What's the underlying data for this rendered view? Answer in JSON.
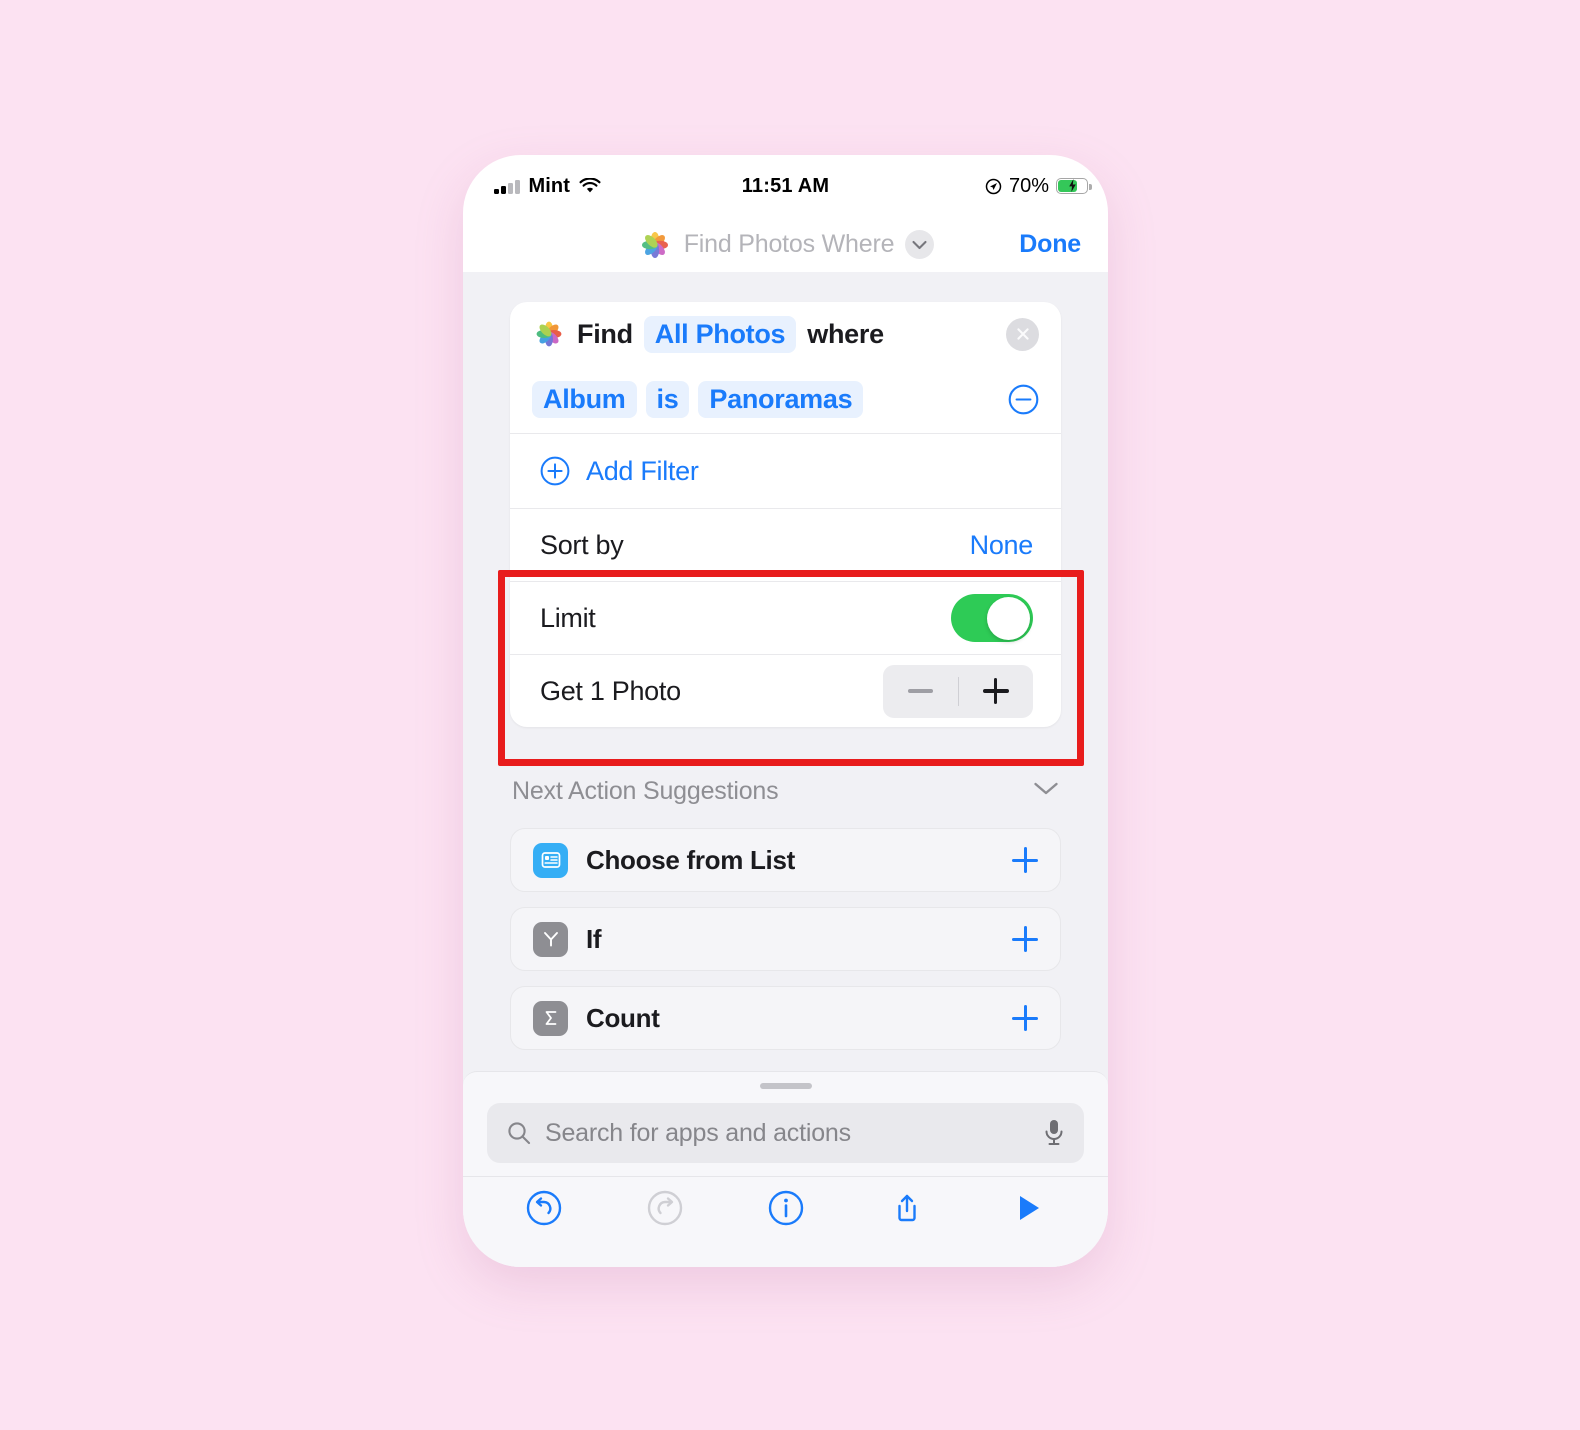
{
  "status_bar": {
    "carrier": "Mint",
    "time": "11:51 AM",
    "battery_percent": "70%",
    "signal_icon": "cellular-bars-icon",
    "wifi_icon": "wifi-icon",
    "location_icon": "location-arrow-icon",
    "battery_icon": "battery-charging-icon"
  },
  "nav_bar": {
    "app_icon": "photos-app-icon",
    "title": "Find Photos Where",
    "chevron_icon": "chevron-down-icon",
    "done_label": "Done"
  },
  "action_card": {
    "find_row": {
      "app_icon": "photos-app-icon",
      "word_find": "Find",
      "token_scope": "All Photos",
      "word_where": "where",
      "close_icon": "close-circle-icon"
    },
    "filter_row": {
      "attribute": "Album",
      "operator": "is",
      "value": "Panoramas",
      "remove_icon": "minus-circle-icon"
    },
    "add_filter": {
      "icon": "plus-circle-icon",
      "label": "Add Filter"
    },
    "sort_by": {
      "label": "Sort by",
      "value": "None"
    },
    "limit": {
      "label": "Limit",
      "toggle_state": "on",
      "toggle_color": "#2ecb56"
    },
    "get_count": {
      "label": "Get 1 Photo",
      "minus_icon": "minus-icon",
      "plus_icon": "plus-icon",
      "minus_enabled": false,
      "plus_enabled": true
    }
  },
  "suggestions": {
    "header": "Next Action Suggestions",
    "collapse_icon": "chevron-down-icon",
    "items": [
      {
        "label": "Choose from List",
        "icon": "choose-from-list-icon",
        "icon_color": "#35aef5",
        "glyph": "list",
        "add_icon": "plus-icon"
      },
      {
        "label": "If",
        "icon": "if-branch-icon",
        "icon_color": "#8e8e93",
        "glyph": "branch",
        "add_icon": "plus-icon"
      },
      {
        "label": "Count",
        "icon": "count-sigma-icon",
        "icon_color": "#8e8e93",
        "glyph": "sigma",
        "add_icon": "plus-icon"
      }
    ]
  },
  "bottom_sheet": {
    "grabber": "sheet-grabber",
    "search": {
      "placeholder": "Search for apps and actions",
      "search_icon": "search-icon",
      "mic_icon": "microphone-icon"
    }
  },
  "toolbar": {
    "buttons": [
      {
        "name": "undo-button",
        "icon": "undo-icon",
        "enabled": true
      },
      {
        "name": "redo-button",
        "icon": "redo-icon",
        "enabled": false
      },
      {
        "name": "info-button",
        "icon": "info-circle-icon",
        "enabled": true
      },
      {
        "name": "share-button",
        "icon": "share-icon",
        "enabled": true
      },
      {
        "name": "run-button",
        "icon": "play-icon",
        "enabled": true
      }
    ]
  },
  "annotation": {
    "highlight_color": "#e81c1c",
    "target": "limit-and-get-count-rows"
  },
  "theme": {
    "accent_blue": "#1a7bfb",
    "toggle_green": "#2ecb56",
    "page_background": "#fce2f2",
    "content_background": "#f1f1f5"
  }
}
